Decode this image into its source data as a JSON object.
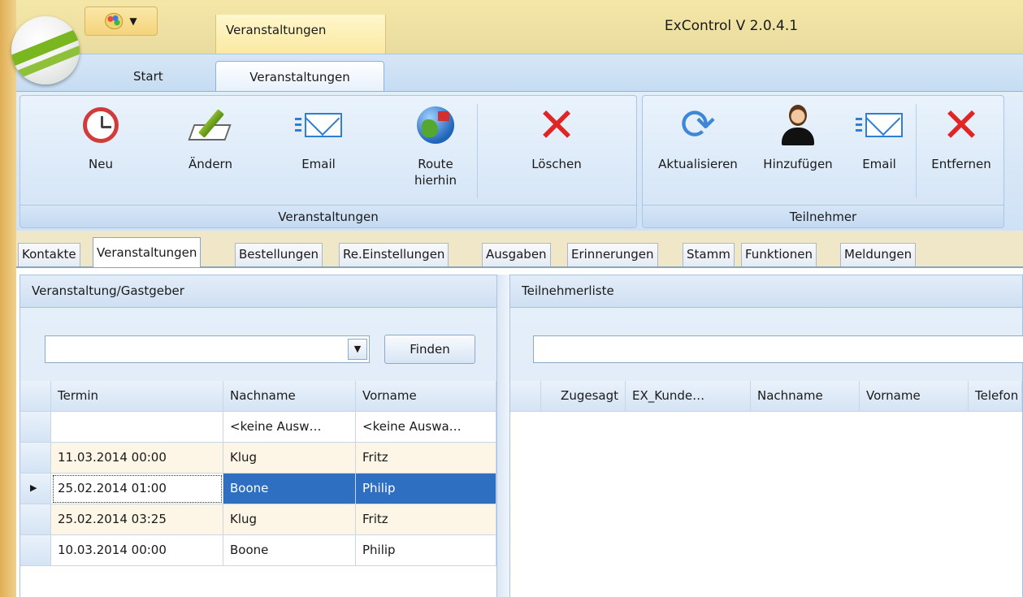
{
  "window": {
    "title": "ExControl V 2.0.4.1",
    "context_tab_title": "Veranstaltungen"
  },
  "ribbon": {
    "tabs": [
      {
        "label": "Start",
        "active": false
      },
      {
        "label": "Veranstaltungen",
        "active": true
      }
    ],
    "groups": [
      {
        "label": "Veranstaltungen",
        "buttons": [
          {
            "label": "Neu",
            "icon": "alarm-clock-icon"
          },
          {
            "label": "Ändern",
            "icon": "pencil-icon"
          },
          {
            "label": "Email",
            "icon": "email-icon"
          },
          {
            "label_line1": "Route",
            "label_line2": "hierhin",
            "icon": "globe-route-icon"
          },
          {
            "label": "Löschen",
            "icon": "delete-icon"
          }
        ]
      },
      {
        "label": "Teilnehmer",
        "buttons": [
          {
            "label": "Aktualisieren",
            "icon": "refresh-icon"
          },
          {
            "label": "Hinzufügen",
            "icon": "person-add-icon"
          },
          {
            "label": "Email",
            "icon": "email-icon"
          },
          {
            "label": "Entfernen",
            "icon": "remove-icon"
          }
        ]
      }
    ]
  },
  "main_tabs": [
    {
      "label": "Kontakte"
    },
    {
      "label": "Veranstaltungen",
      "active": true
    },
    {
      "label": "Bestellungen"
    },
    {
      "label": "Re.Einstellungen"
    },
    {
      "label": "Ausgaben"
    },
    {
      "label": "Erinnerungen"
    },
    {
      "label": "Stamm"
    },
    {
      "label": "Funktionen"
    },
    {
      "label": "Meldungen"
    }
  ],
  "left_panel": {
    "title": "Veranstaltung/Gastgeber",
    "combo_value": "",
    "find_button": "Finden",
    "columns": [
      "Termin",
      "Nachname",
      "Vorname"
    ],
    "filter_row": [
      "",
      "<keine Ausw…",
      "<keine Auswa…"
    ],
    "rows": [
      {
        "termin": "11.03.2014 00:00",
        "nachname": "Klug",
        "vorname": "Fritz"
      },
      {
        "termin": "25.02.2014 01:00",
        "nachname": "Boone",
        "vorname": "Philip",
        "selected": true
      },
      {
        "termin": "25.02.2014 03:25",
        "nachname": "Klug",
        "vorname": "Fritz"
      },
      {
        "termin": "10.03.2014 00:00",
        "nachname": "Boone",
        "vorname": "Philip"
      }
    ]
  },
  "right_panel": {
    "title": "Teilnehmerliste",
    "search_value": "",
    "columns": [
      "Zugesagt",
      "EX_Kunde…",
      "Nachname",
      "Vorname",
      "Telefon"
    ]
  },
  "colors": {
    "selection": "#2f6fc1",
    "ribbon": "#cfe1f5",
    "title_bar": "#f4e7a6"
  }
}
